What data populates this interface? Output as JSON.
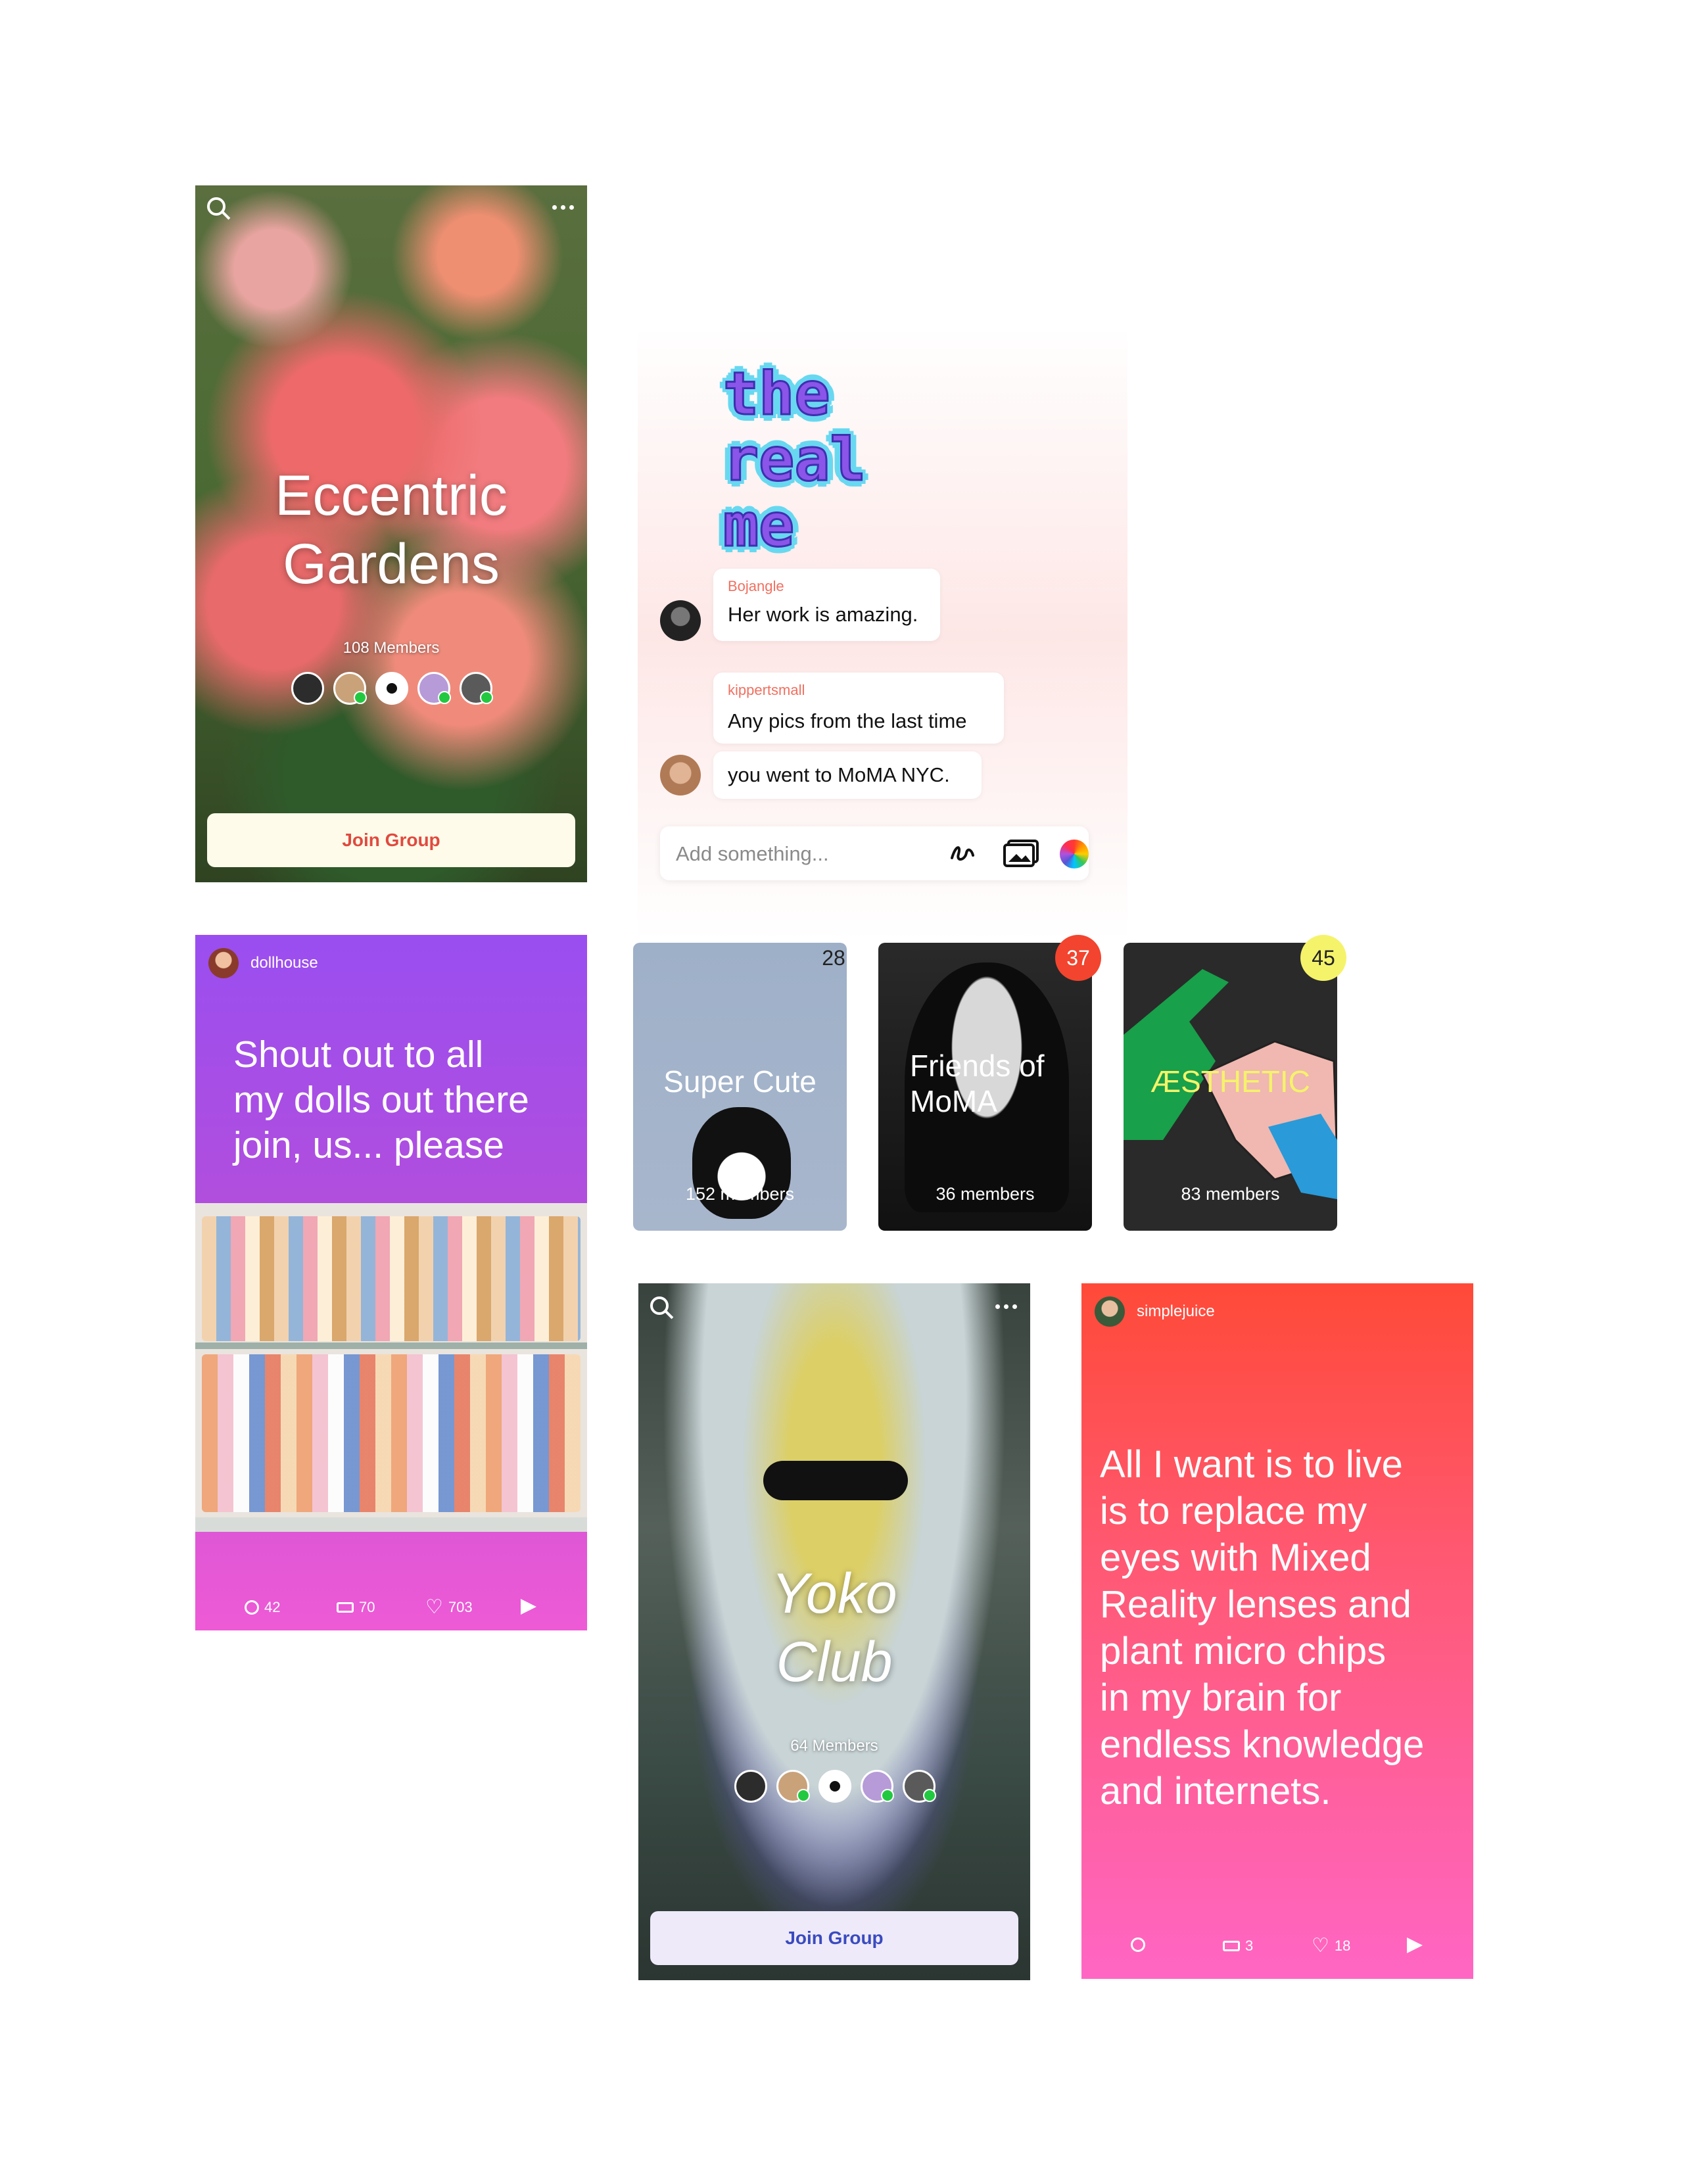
{
  "gardens": {
    "title_line1": "Eccentric",
    "title_line2": "Gardens",
    "members": "108 Members",
    "join_label": "Join Group"
  },
  "chat": {
    "sticker_line1": "the",
    "sticker_line2": "real",
    "sticker_line3": "me",
    "messages": [
      {
        "author": "Bojangle",
        "text": "Her work is amazing."
      },
      {
        "author": "kippertsmall",
        "text": "Any pics from the last time"
      },
      {
        "author": "",
        "text": "you went to MoMA NYC."
      }
    ],
    "composer_placeholder": "Add something..."
  },
  "dollhouse": {
    "username": "dollhouse",
    "text_line1": "Shout out to all",
    "text_line2": "my dolls out there",
    "text_line3": "join, us... please",
    "comments": "42",
    "reposts": "70",
    "likes": "703"
  },
  "groups": [
    {
      "title": "Super Cute",
      "members": "152 members",
      "badge": "28",
      "badge_color": "#fbe6f0"
    },
    {
      "title_line1": "Friends of",
      "title_line2": "MoMA",
      "members": "36 members",
      "badge": "37",
      "badge_color": "#f2442e"
    },
    {
      "title": "ÆSTHETIC",
      "members": "83 members",
      "badge": "45",
      "badge_color": "#f5f36a"
    }
  ],
  "yoko": {
    "title_line1": "Yoko",
    "title_line2": "Club",
    "members": "64 Members",
    "join_label": "Join Group"
  },
  "simplejuice": {
    "username": "simplejuice",
    "text_lines": [
      "All I want is to live",
      "is to replace my",
      "eyes with Mixed",
      "Reality lenses and",
      "plant micro chips",
      "in my brain for",
      "endless knowledge",
      "and internets."
    ],
    "reposts": "3",
    "likes": "18"
  }
}
